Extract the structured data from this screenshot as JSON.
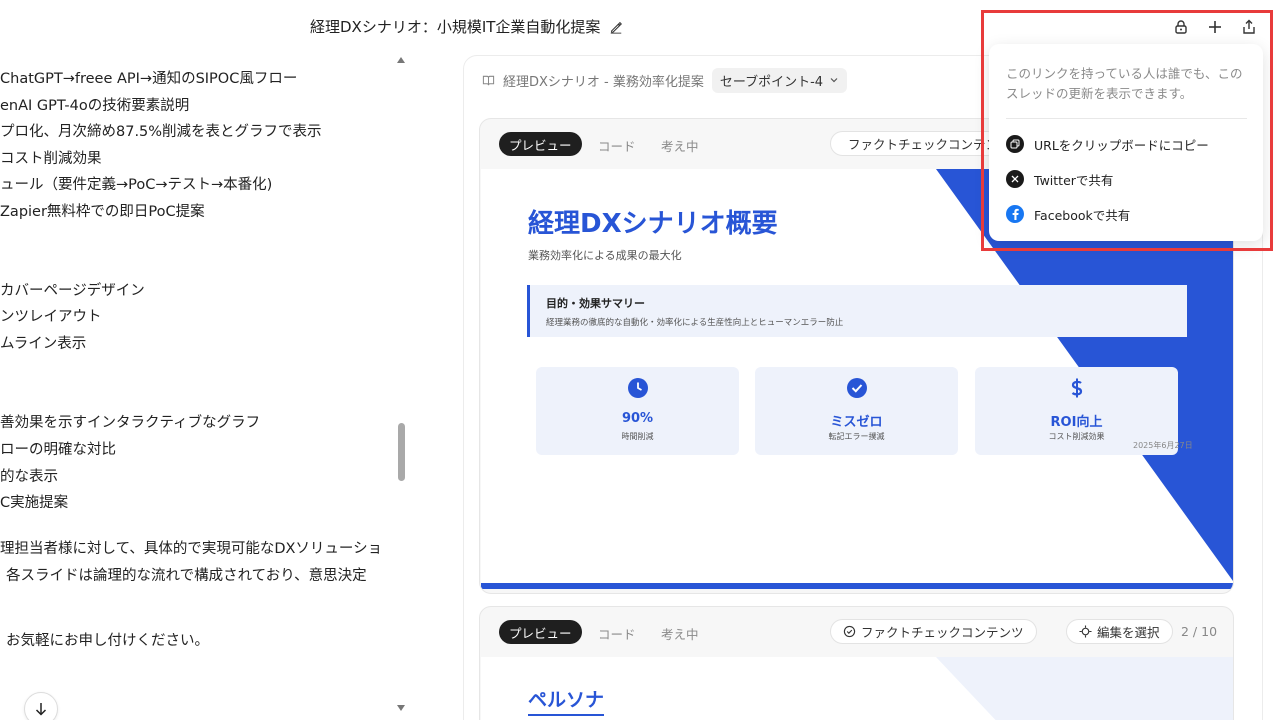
{
  "header": {
    "title": "経理DXシナリオ：小規模IT企業自動化提案"
  },
  "chat": {
    "lines": [
      "ChatGPT→freee API→通知のSIPOC風フロー",
      "enAI GPT-4oの技術要素説明",
      "プロ化、月次締め87.5%削減を表とグラフで表示",
      "コスト削減効果",
      "ュール（要件定義→PoC→テスト→本番化)",
      "Zapier無料枠での即日PoC提案",
      "カバーページデザイン",
      "ンツレイアウト",
      "ムライン表示",
      "善効果を示すインタラクティブなグラフ",
      "ローの明確な対比",
      "的な表示",
      "C実施提案",
      "理担当者様に対して、具体的で実現可能なDXソリューショ",
      "各スライドは論理的な流れで構成されており、意思決定",
      "お気軽にお申し付けください。"
    ]
  },
  "panel": {
    "title": "経理DXシナリオ - 業務効率化提案",
    "savepoint": "セーブポイント-4"
  },
  "cards": [
    {
      "tabs": {
        "preview": "プレビュー",
        "code": "コード",
        "thinking": "考え中"
      },
      "factcheck": "ファクトチェックコンテンツ",
      "slide": {
        "title": "経理DXシナリオ概要",
        "subtitle": "業務効率化による成果の最大化",
        "summary_heading": "目的・効果サマリー",
        "summary_text": "経理業務の徹底的な自動化・効率化による生産性向上とヒューマンエラー防止",
        "metrics": [
          {
            "icon": "clock-icon",
            "value": "90%",
            "label": "時間削減"
          },
          {
            "icon": "check-circle-icon",
            "value": "ミスゼロ",
            "label": "転記エラー撲滅"
          },
          {
            "icon": "dollar-icon",
            "value": "ROI向上",
            "label": "コスト削減効果"
          }
        ],
        "date": "2025年6月27日"
      }
    },
    {
      "tabs": {
        "preview": "プレビュー",
        "code": "コード",
        "thinking": "考え中"
      },
      "factcheck": "ファクトチェックコンテンツ",
      "select_edit": "編集を選択",
      "page_count": "2 / 10",
      "slide": {
        "title": "ペルソナ"
      }
    }
  ],
  "share_popover": {
    "note": "このリンクを持っている人は誰でも、このスレッドの更新を表示できます。",
    "items": [
      {
        "icon": "copy-icon",
        "label": "URLをクリップボードにコピー"
      },
      {
        "icon": "twitter-x-icon",
        "label": "Twitterで共有"
      },
      {
        "icon": "facebook-icon",
        "label": "Facebookで共有"
      }
    ]
  },
  "colors": {
    "accent": "#2855d6",
    "highlight": "#e83b3b",
    "dark_pill": "#1f1f1f"
  }
}
